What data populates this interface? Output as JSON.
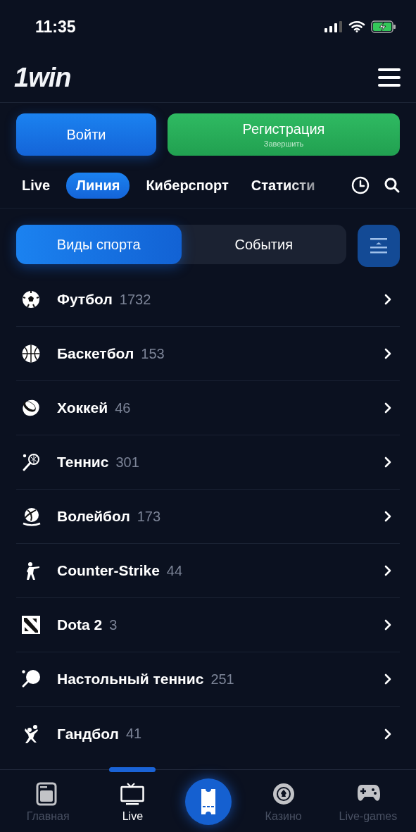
{
  "status_bar": {
    "time": "11:35"
  },
  "header": {
    "logo": "1win"
  },
  "auth": {
    "login": "Войти",
    "register": "Регистрация",
    "register_hint": "Завершить"
  },
  "tabs": [
    {
      "label": "Live",
      "selected": false
    },
    {
      "label": "Линия",
      "selected": true
    },
    {
      "label": "Киберспорт",
      "selected": false
    },
    {
      "label": "Статисти",
      "selected": false
    }
  ],
  "segments": [
    {
      "label": "Виды спорта",
      "selected": true
    },
    {
      "label": "События",
      "selected": false
    }
  ],
  "sports": [
    {
      "kind": "football",
      "name": "Футбол",
      "count": "1732"
    },
    {
      "kind": "basketball",
      "name": "Баскетбол",
      "count": "153"
    },
    {
      "kind": "hockey",
      "name": "Хоккей",
      "count": "46"
    },
    {
      "kind": "tennis",
      "name": "Теннис",
      "count": "301"
    },
    {
      "kind": "volleyball",
      "name": "Волейбол",
      "count": "173"
    },
    {
      "kind": "shooter",
      "name": "Counter-Strike",
      "count": "44"
    },
    {
      "kind": "moba",
      "name": "Dota 2",
      "count": "3"
    },
    {
      "kind": "pingpong",
      "name": "Настольный теннис",
      "count": "251"
    },
    {
      "kind": "handball",
      "name": "Гандбол",
      "count": "41"
    }
  ],
  "bottom_nav": [
    {
      "kind": "home",
      "label": "Главная",
      "selected": false
    },
    {
      "kind": "tv",
      "label": "Live",
      "selected": true
    },
    {
      "kind": "ticket",
      "selected": false
    },
    {
      "kind": "casino",
      "label": "Казино",
      "selected": false
    },
    {
      "kind": "gamepad",
      "label": "Live-games",
      "selected": false
    }
  ]
}
